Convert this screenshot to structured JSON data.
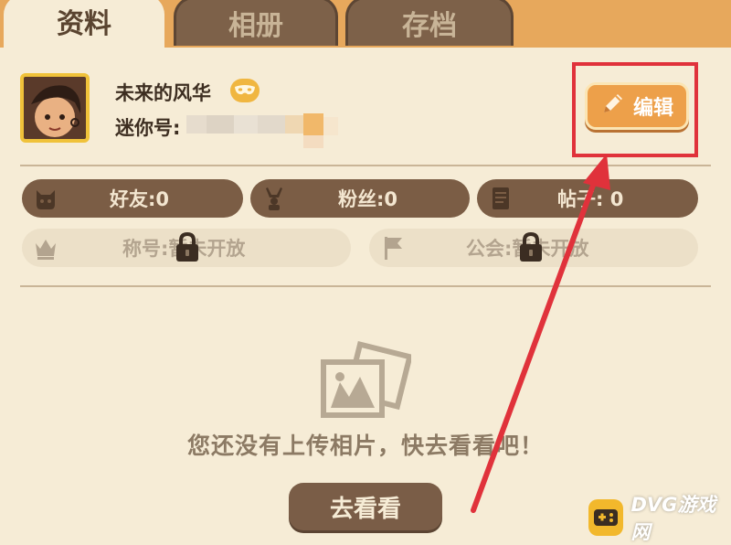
{
  "tabs": [
    {
      "label": "资料",
      "active": true
    },
    {
      "label": "相册",
      "active": false
    },
    {
      "label": "存档",
      "active": false
    }
  ],
  "profile": {
    "nickname": "未来的风华",
    "mini_id_label": "迷你号:",
    "edit_label": "编辑",
    "badge_icon": "mask-icon"
  },
  "stats": {
    "friends": "好友:0",
    "fans": "粉丝:0",
    "posts": "帖子: 0",
    "title": "称号:暂未开放",
    "guild": "公会:暂未开放"
  },
  "album": {
    "empty_text": "您还没有上传相片，快去看看吧！",
    "go_button": "去看看"
  },
  "watermark": {
    "text": "DVG游戏网"
  },
  "colors": {
    "background": "#f6ecd6",
    "tab_bar": "#e7a85c",
    "pill_dark": "#7b5d45",
    "accent_orange": "#eda04a",
    "highlight_red": "#e0323b"
  }
}
